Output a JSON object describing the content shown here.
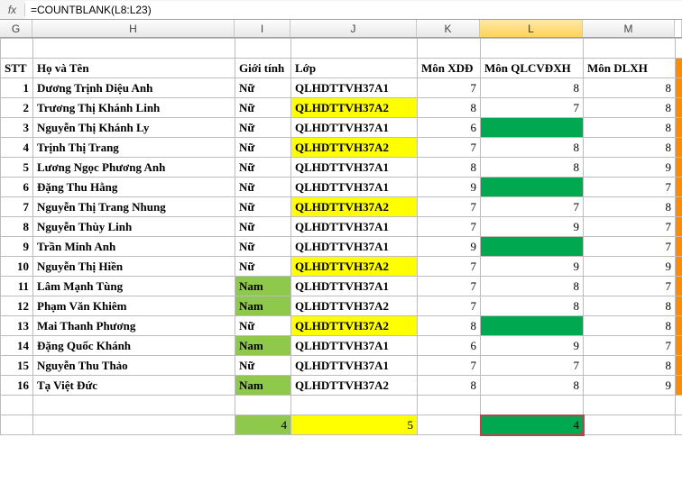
{
  "formula_bar": {
    "fx_label": "fx",
    "formula": "=COUNTBLANK(L8:L23)"
  },
  "columns": {
    "G": "G",
    "H": "H",
    "I": "I",
    "J": "J",
    "K": "K",
    "L": "L",
    "M": "M"
  },
  "headers": {
    "stt": "STT",
    "ho_ten": "Họ và Tên",
    "gioi_tinh": "Giới tính",
    "lop": "Lớp",
    "mon_xdd": "Môn XDĐ",
    "mon_qlcvdxh": "Môn QLCVĐXH",
    "mon_dlxh": "Môn DLXH"
  },
  "rows": [
    {
      "stt": "1",
      "ho_ten": "Dương Trịnh Diệu Anh",
      "gioi_tinh": "Nữ",
      "gt_hl": "",
      "lop": "QLHDTTVH37A1",
      "lop_hl": "",
      "xdd": "7",
      "ql": "8",
      "dl": "8"
    },
    {
      "stt": "2",
      "ho_ten": "Trương Thị Khánh Linh",
      "gioi_tinh": "Nữ",
      "gt_hl": "",
      "lop": "QLHDTTVH37A2",
      "lop_hl": "yellow",
      "xdd": "8",
      "ql": "7",
      "dl": "8"
    },
    {
      "stt": "3",
      "ho_ten": "Nguyễn Thị Khánh Ly",
      "gioi_tinh": "Nữ",
      "gt_hl": "",
      "lop": "QLHDTTVH37A1",
      "lop_hl": "",
      "xdd": "6",
      "ql": "",
      "ql_hl": "green",
      "dl": "8"
    },
    {
      "stt": "4",
      "ho_ten": "Trịnh Thị Trang",
      "gioi_tinh": "Nữ",
      "gt_hl": "",
      "lop": "QLHDTTVH37A2",
      "lop_hl": "yellow",
      "xdd": "7",
      "ql": "8",
      "dl": "8"
    },
    {
      "stt": "5",
      "ho_ten": "Lương Ngọc Phương Anh",
      "gioi_tinh": "Nữ",
      "gt_hl": "",
      "lop": "QLHDTTVH37A1",
      "lop_hl": "",
      "xdd": "8",
      "ql": "8",
      "dl": "9"
    },
    {
      "stt": "6",
      "ho_ten": "Đặng Thu Hằng",
      "gioi_tinh": "Nữ",
      "gt_hl": "",
      "lop": "QLHDTTVH37A1",
      "lop_hl": "",
      "xdd": "9",
      "ql": "",
      "ql_hl": "green",
      "dl": "7"
    },
    {
      "stt": "7",
      "ho_ten": "Nguyễn Thị Trang Nhung",
      "gioi_tinh": "Nữ",
      "gt_hl": "",
      "lop": "QLHDTTVH37A2",
      "lop_hl": "yellow",
      "xdd": "7",
      "ql": "7",
      "dl": "8"
    },
    {
      "stt": "8",
      "ho_ten": "Nguyễn Thùy Linh",
      "gioi_tinh": "Nữ",
      "gt_hl": "",
      "lop": "QLHDTTVH37A1",
      "lop_hl": "",
      "xdd": "7",
      "ql": "9",
      "dl": "7"
    },
    {
      "stt": "9",
      "ho_ten": "Trần Minh Anh",
      "gioi_tinh": "Nữ",
      "gt_hl": "",
      "lop": "QLHDTTVH37A1",
      "lop_hl": "",
      "xdd": "9",
      "ql": "",
      "ql_hl": "green",
      "dl": "7"
    },
    {
      "stt": "10",
      "ho_ten": "Nguyễn Thị Hiền",
      "gioi_tinh": "Nữ",
      "gt_hl": "",
      "lop": "QLHDTTVH37A2",
      "lop_hl": "yellow",
      "xdd": "7",
      "ql": "9",
      "dl": "9"
    },
    {
      "stt": "11",
      "ho_ten": "Lâm Mạnh Tùng",
      "gioi_tinh": "Nam",
      "gt_hl": "lime",
      "lop": "QLHDTTVH37A1",
      "lop_hl": "",
      "xdd": "7",
      "ql": "8",
      "dl": "7"
    },
    {
      "stt": "12",
      "ho_ten": "Phạm Văn Khiêm",
      "gioi_tinh": "Nam",
      "gt_hl": "lime",
      "lop": "QLHDTTVH37A2",
      "lop_hl": "",
      "xdd": "7",
      "ql": "8",
      "dl": "8"
    },
    {
      "stt": "13",
      "ho_ten": "Mai Thanh Phương",
      "gioi_tinh": "Nữ",
      "gt_hl": "",
      "lop": "QLHDTTVH37A2",
      "lop_hl": "yellow",
      "xdd": "8",
      "ql": "",
      "ql_hl": "green",
      "dl": "8"
    },
    {
      "stt": "14",
      "ho_ten": "Đặng Quốc Khánh",
      "gioi_tinh": "Nam",
      "gt_hl": "lime",
      "lop": "QLHDTTVH37A1",
      "lop_hl": "",
      "xdd": "6",
      "ql": "9",
      "dl": "7"
    },
    {
      "stt": "15",
      "ho_ten": "Nguyễn Thu Thảo",
      "gioi_tinh": "Nữ",
      "gt_hl": "",
      "lop": "QLHDTTVH37A1",
      "lop_hl": "",
      "xdd": "7",
      "ql": "7",
      "dl": "8"
    },
    {
      "stt": "16",
      "ho_ten": "Tạ Việt Đức",
      "gioi_tinh": "Nam",
      "gt_hl": "lime",
      "lop": "QLHDTTVH37A2",
      "lop_hl": "",
      "xdd": "8",
      "ql": "8",
      "dl": "9"
    }
  ],
  "summary": {
    "i_value": "4",
    "j_value": "5",
    "l_value": "4"
  }
}
